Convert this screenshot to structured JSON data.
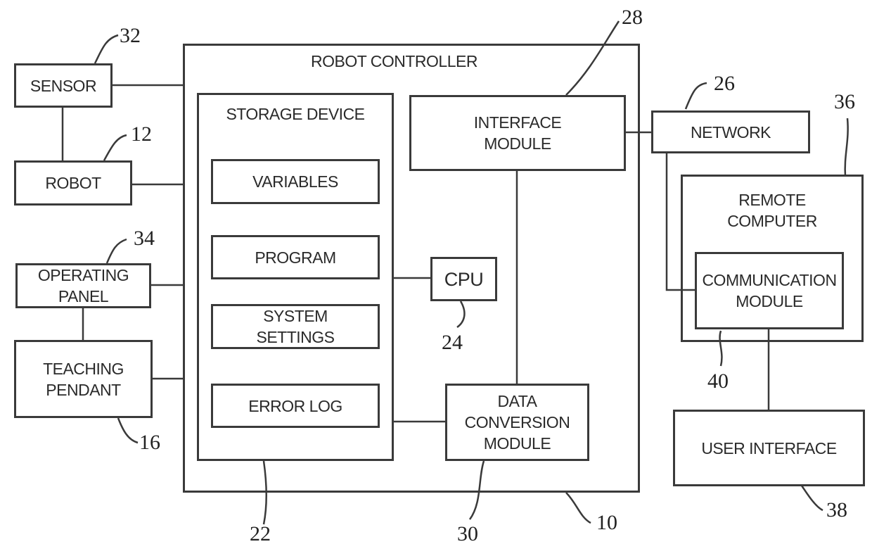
{
  "diagram": {
    "robot_controller": {
      "label": "ROBOT CONTROLLER",
      "ref": "10"
    },
    "sensor": {
      "label": "SENSOR",
      "ref": "32"
    },
    "robot": {
      "label": "ROBOT",
      "ref": "12"
    },
    "operating_panel": {
      "label": "OPERATING\nPANEL",
      "ref": "34"
    },
    "teaching_pendant": {
      "label": "TEACHING\nPENDANT",
      "ref": "16"
    },
    "storage_device": {
      "label": "STORAGE DEVICE",
      "ref": "22"
    },
    "variables": {
      "label": "VARIABLES"
    },
    "program": {
      "label": "PROGRAM"
    },
    "system_settings": {
      "label": "SYSTEM\nSETTINGS"
    },
    "error_log": {
      "label": "ERROR LOG"
    },
    "cpu": {
      "label": "CPU",
      "ref": "24"
    },
    "interface_module": {
      "label": "INTERFACE\nMODULE",
      "ref": "28"
    },
    "data_conversion_module": {
      "label": "DATA\nCONVERSION\nMODULE",
      "ref": "30"
    },
    "network": {
      "label": "NETWORK",
      "ref": "26"
    },
    "remote_computer": {
      "label": "REMOTE\nCOMPUTER",
      "ref": "36"
    },
    "communication_module": {
      "label": "COMMUNICATION\nMODULE",
      "ref": "40"
    },
    "user_interface": {
      "label": "USER INTERFACE",
      "ref": "38"
    }
  }
}
